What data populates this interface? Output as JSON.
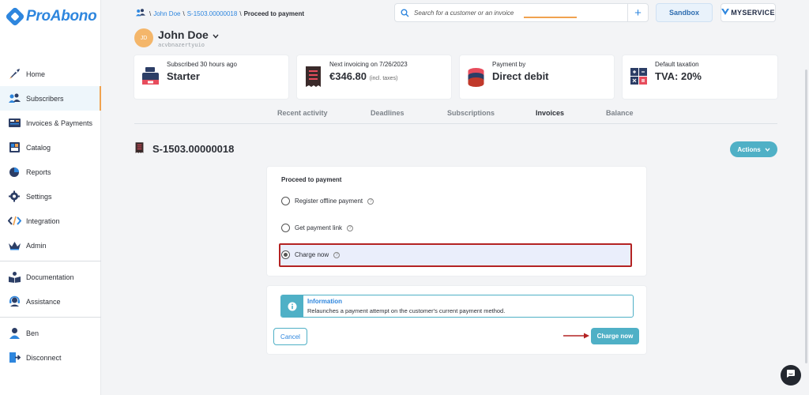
{
  "app": {
    "name": "ProAbono"
  },
  "sidebar": {
    "items": [
      {
        "label": "Home",
        "icon": "rocket-icon"
      },
      {
        "label": "Subscribers",
        "icon": "users-icon",
        "active": true
      },
      {
        "label": "Invoices & Payments",
        "icon": "invoices-icon"
      },
      {
        "label": "Catalog",
        "icon": "catalog-icon"
      },
      {
        "label": "Reports",
        "icon": "pie-chart-icon"
      },
      {
        "label": "Settings",
        "icon": "gear-icon"
      },
      {
        "label": "Integration",
        "icon": "code-icon"
      },
      {
        "label": "Admin",
        "icon": "crown-icon"
      },
      {
        "label": "Documentation",
        "icon": "book-icon"
      },
      {
        "label": "Assistance",
        "icon": "headset-icon"
      },
      {
        "label": "Ben",
        "icon": "user-icon"
      },
      {
        "label": "Disconnect",
        "icon": "logout-icon"
      }
    ]
  },
  "breadcrumb": {
    "customer": "John Doe",
    "invoice": "S-1503.00000018",
    "current": "Proceed to payment"
  },
  "search": {
    "placeholder": "Search for a customer or an invoice"
  },
  "header": {
    "sandbox_label": "Sandbox",
    "business_label": "MYSERVICE"
  },
  "customer": {
    "initials": "JD",
    "name": "John Doe",
    "id": "acvbnazertyuio"
  },
  "cards": [
    {
      "label": "Subscribed 30 hours ago",
      "value": "Starter",
      "suffix": "",
      "icon": "cash-register-icon"
    },
    {
      "label": "Next invoicing on 7/26/2023",
      "value": "€346.80",
      "suffix": "(incl. taxes)",
      "icon": "receipt-icon"
    },
    {
      "label": "Payment by",
      "value": "Direct debit",
      "suffix": "",
      "icon": "coins-stack-icon"
    },
    {
      "label": "Default taxation",
      "value": "TVA: 20%",
      "suffix": "",
      "icon": "calculator-icon"
    }
  ],
  "tabs": [
    {
      "label": "Recent activity"
    },
    {
      "label": "Deadlines"
    },
    {
      "label": "Subscriptions"
    },
    {
      "label": "Invoices",
      "active": true
    },
    {
      "label": "Balance"
    }
  ],
  "invoice": {
    "number": "S-1503.00000018",
    "actions_label": "Actions"
  },
  "payment": {
    "title": "Proceed to payment",
    "options": [
      {
        "label": "Register offline payment",
        "selected": false
      },
      {
        "label": "Get payment link",
        "selected": false
      },
      {
        "label": "Charge now",
        "selected": true
      }
    ],
    "info_title": "Information",
    "info_text": "Relaunches a payment attempt on the customer's current payment method.",
    "cancel_label": "Cancel",
    "submit_label": "Charge now"
  },
  "colors": {
    "accent": "#4fb0c6",
    "brand": "#2e86de",
    "tab_underline": "#f0a24f",
    "highlight_border": "#b42323"
  }
}
